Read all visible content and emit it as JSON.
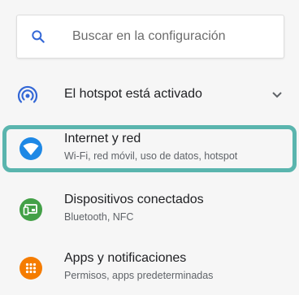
{
  "search": {
    "placeholder": "Buscar en la configuración",
    "icon": "search-icon",
    "icon_color": "#3367d6"
  },
  "hotspot_banner": {
    "text": "El hotspot está activado",
    "icon": "hotspot-icon",
    "icon_color": "#3367d6",
    "expand_icon": "chevron-down-icon"
  },
  "settings": [
    {
      "title": "Internet y red",
      "subtitle": "Wi-Fi, red móvil, uso de datos, hotspot",
      "icon": "wifi-icon",
      "color": "#1e88e5"
    },
    {
      "title": "Dispositivos conectados",
      "subtitle": "Bluetooth, NFC",
      "icon": "connected-devices-icon",
      "color": "#43a047"
    },
    {
      "title": "Apps y notificaciones",
      "subtitle": "Permisos, apps predeterminadas",
      "icon": "apps-grid-icon",
      "color": "#f57c00"
    }
  ],
  "highlight_color": "#5ab5ae"
}
